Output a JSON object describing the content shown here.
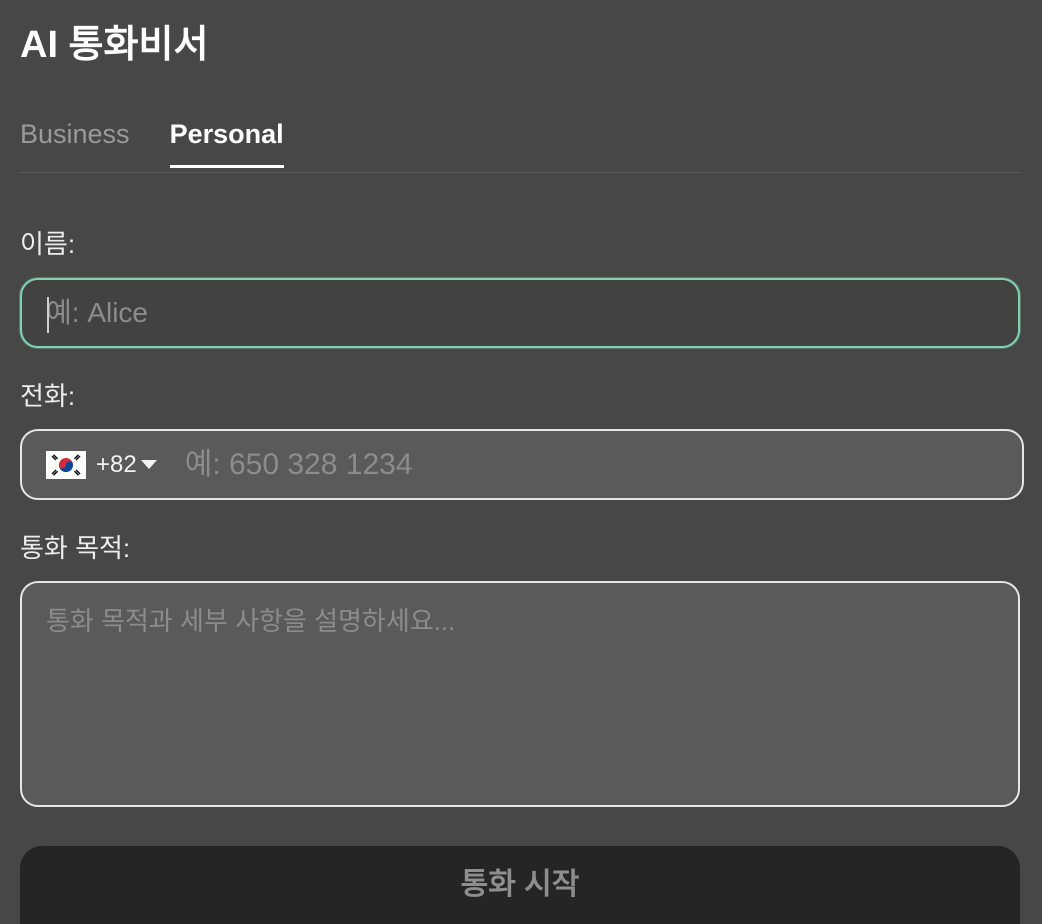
{
  "app": {
    "title": "AI 통화비서"
  },
  "tabs": [
    {
      "label": "Business",
      "active": false
    },
    {
      "label": "Personal",
      "active": true
    }
  ],
  "form": {
    "name": {
      "label": "이름:",
      "value": "",
      "placeholder": "예: Alice"
    },
    "phone": {
      "label": "전화:",
      "country_flag_icon": "south-korea-flag-icon",
      "country_code": "+82",
      "value": "",
      "placeholder": "예: 650 328 1234"
    },
    "purpose": {
      "label": "통화 목적:",
      "value": "",
      "placeholder": "통화 목적과 세부 사항을 설명하세요..."
    }
  },
  "actions": {
    "start_call_label": "통화 시작"
  },
  "colors": {
    "background": "#474747",
    "focus_border": "#7fd3b1",
    "button_bg": "#252525",
    "button_text": "#8e8e8e"
  }
}
